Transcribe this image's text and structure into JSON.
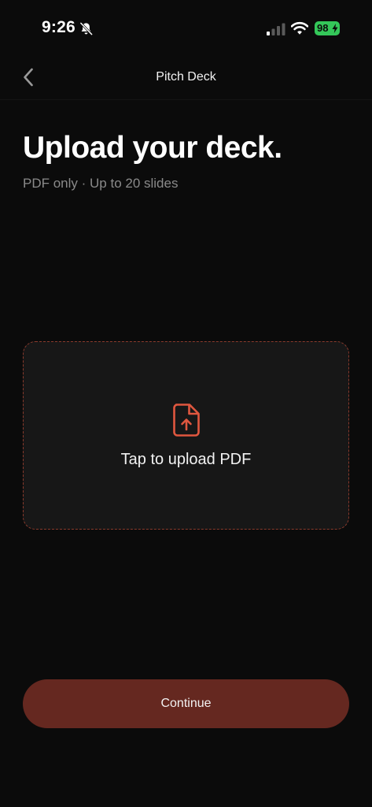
{
  "status_bar": {
    "time": "9:26",
    "battery": "98",
    "icons": [
      "bell-slash-icon",
      "signal-icon",
      "wifi-icon",
      "battery-icon",
      "bolt-icon"
    ]
  },
  "nav": {
    "title": "Pitch Deck",
    "back_icon": "chevron-left-icon"
  },
  "header": {
    "title": "Upload your deck.",
    "subtitle": "PDF only · Up to 20 slides"
  },
  "upload": {
    "label": "Tap to upload PDF",
    "icon": "file-upload-icon"
  },
  "footer": {
    "continue_label": "Continue"
  },
  "colors": {
    "background": "#0b0b0b",
    "accent": "#e0573f",
    "dashed_border": "#8a3a2c",
    "button": "#652820",
    "battery": "#34c759",
    "muted_text": "#8a8a8a"
  }
}
